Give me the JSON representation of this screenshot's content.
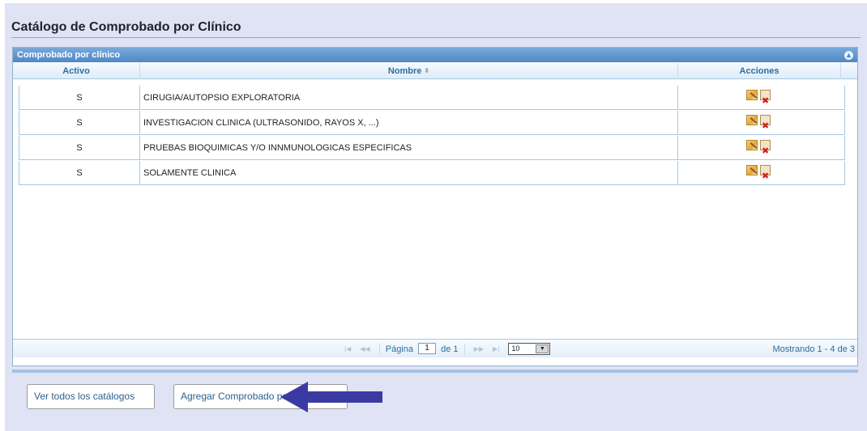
{
  "page": {
    "title": "Catálogo de Comprobado por Clínico"
  },
  "grid": {
    "caption": "Comprobado por clínico",
    "collapse_icon": "triangle-up-circle-icon",
    "columns": [
      {
        "label": "Activo",
        "sort_icon": ""
      },
      {
        "label": "Nombre",
        "sort_icon": "▲▼"
      },
      {
        "label": "Acciones",
        "sort_icon": ""
      }
    ],
    "rows": [
      {
        "activo": "S",
        "nombre": "CIRUGIA/AUTOPSIO EXPLORATORIA"
      },
      {
        "activo": "S",
        "nombre": "INVESTIGACION CLINICA (ULTRASONIDO, RAYOS X, ...)"
      },
      {
        "activo": "S",
        "nombre": "PRUEBAS BIOQUIMICAS Y/O INNMUNOLOGICAS ESPECIFICAS"
      },
      {
        "activo": "S",
        "nombre": "SOLAMENTE CLINICA"
      }
    ],
    "row_actions": [
      "edit-icon",
      "delete-icon"
    ],
    "pager": {
      "page_label": "Página",
      "page_value": "1",
      "of_label": "de 1",
      "page_size": "10",
      "info": "Mostrando 1 - 4 de 3",
      "first_icon": "|◀",
      "prev_icon": "◀◀",
      "next_icon": "▶▶",
      "last_icon": "▶|"
    }
  },
  "footer": {
    "view_all_label": "Ver todos los catálogos",
    "add_label": "Agregar Comprobado por Clínico"
  },
  "colors": {
    "panel_bg": "#dfe3f3",
    "caption_bg": "#4f88c6",
    "header_text": "#2e6e9e",
    "arrow_annotation": "#3b3aa2"
  }
}
